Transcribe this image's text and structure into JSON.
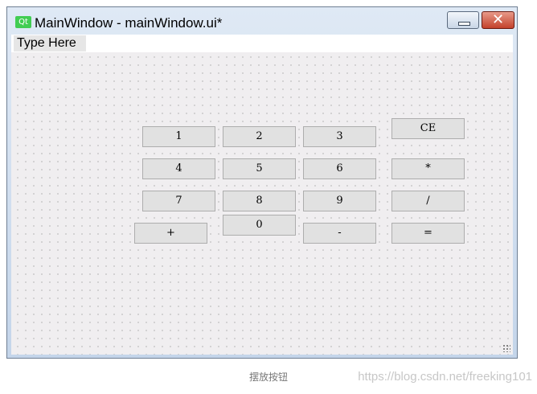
{
  "window": {
    "icon_label": "Qt",
    "title": "MainWindow - mainWindow.ui*",
    "controls": {
      "minimize": "",
      "close": "✕"
    }
  },
  "menubar": {
    "placeholder": "Type Here"
  },
  "buttons": {
    "b1": "1",
    "b2": "2",
    "b3": "3",
    "ce": "CE",
    "b4": "4",
    "b5": "5",
    "b6": "6",
    "mul": "*",
    "b7": "7",
    "b8": "8",
    "b9": "9",
    "div": "/",
    "plus": "+",
    "b0": "0",
    "minus": "-",
    "eq": "="
  },
  "caption": "摆放按钮",
  "watermark": "https://blog.csdn.net/freeking101"
}
